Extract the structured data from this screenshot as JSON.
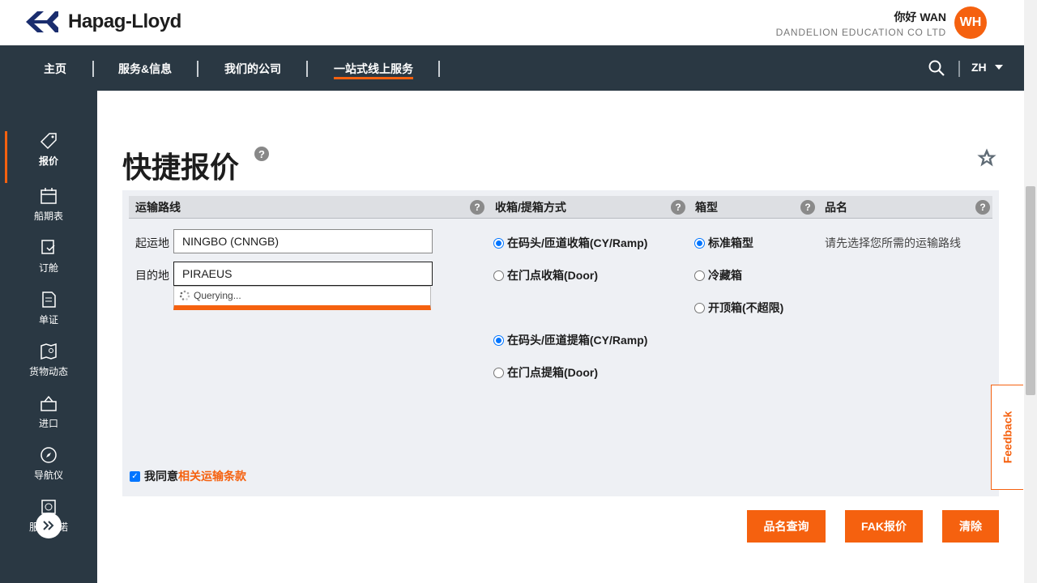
{
  "brand": {
    "name": "Hapag-Lloyd",
    "accent": "#f5610f",
    "nav_bg": "#2a3843"
  },
  "user": {
    "greeting": "你好 WAN",
    "company": "DANDELION EDUCATION CO LTD",
    "initials": "WH"
  },
  "nav": {
    "items": [
      {
        "label": "主页"
      },
      {
        "label": "服务&信息"
      },
      {
        "label": "我们的公司"
      },
      {
        "label": "一站式线上服务",
        "active": true
      }
    ],
    "search_icon": "search-icon",
    "language": "ZH"
  },
  "sidebar": {
    "items": [
      {
        "label": "报价",
        "icon": "tag-icon",
        "active": true
      },
      {
        "label": "船期表",
        "icon": "calendar-icon"
      },
      {
        "label": "订舱",
        "icon": "booking-icon"
      },
      {
        "label": "单证",
        "icon": "document-icon"
      },
      {
        "label": "货物动态",
        "icon": "map-pin-icon"
      },
      {
        "label": "进口",
        "icon": "import-icon"
      },
      {
        "label": "导航仪",
        "icon": "compass-icon"
      },
      {
        "label": "服务承诺",
        "icon": "service-icon"
      }
    ],
    "expand_icon": "double-chevron-right-icon"
  },
  "page": {
    "title": "快捷报价",
    "help_icon": "question-icon",
    "favorite_icon": "star-icon"
  },
  "columns": {
    "route": "运输路线",
    "service": "收箱/提箱方式",
    "container": "箱型",
    "commodity": "品名"
  },
  "route": {
    "origin_label": "起运地",
    "origin_value": "NINGBO (CNNGB)",
    "destination_label": "目的地",
    "destination_value": "PIRAEUS",
    "suggest_status": "Querying..."
  },
  "service": {
    "pickup": [
      {
        "label": "在码头/匝道收箱(CY/Ramp)",
        "selected": true
      },
      {
        "label": "在门点收箱(Door)",
        "selected": false
      }
    ],
    "delivery": [
      {
        "label": "在码头/匝道提箱(CY/Ramp)",
        "selected": true
      },
      {
        "label": "在门点提箱(Door)",
        "selected": false
      }
    ]
  },
  "container": {
    "options": [
      {
        "label": "标准箱型",
        "selected": true
      },
      {
        "label": "冷藏箱",
        "selected": false
      },
      {
        "label": "开顶箱(不超限)",
        "selected": false
      }
    ]
  },
  "commodity": {
    "hint": "请先选择您所需的运输路线"
  },
  "agree": {
    "text": "我同意",
    "link": "相关运输条款",
    "checked": true
  },
  "buttons": {
    "commodity_search": "品名查询",
    "fak_quote": "FAK报价",
    "clear": "清除"
  },
  "feedback": {
    "label": "Feedback"
  }
}
